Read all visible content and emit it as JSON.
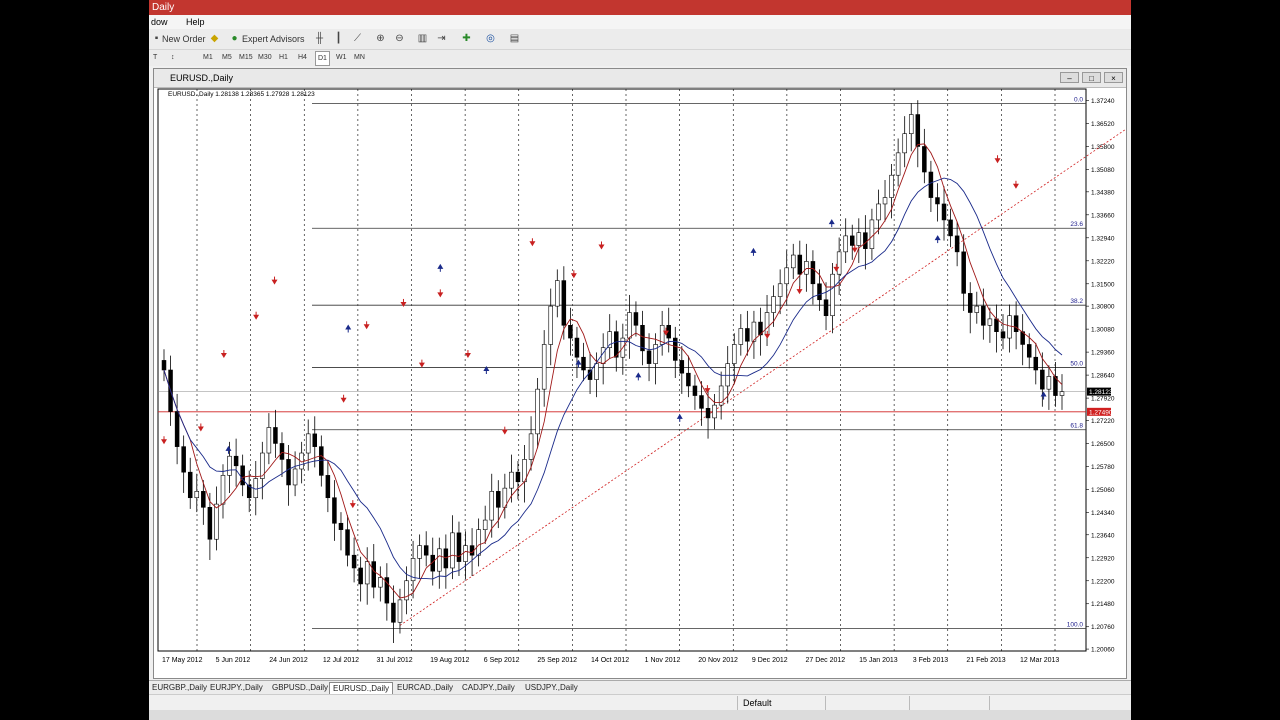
{
  "app": {
    "title": "Daily"
  },
  "menu": [
    "dow",
    "Help"
  ],
  "toolbar": {
    "new_order": "New Order",
    "expert_advisors": "Expert Advisors",
    "timeframes": [
      "M1",
      "M5",
      "M15",
      "M30",
      "H1",
      "H4",
      "D1",
      "W1",
      "MN"
    ],
    "active_timeframe": "D1"
  },
  "chart_window": {
    "title": "EURUSD.,Daily"
  },
  "chart_data": {
    "type": "candlestick",
    "info_line": "EURUSD.,Daily  1.28138 1.28365 1.27928 1.28123",
    "price_labels": [
      "1.37240",
      "1.36520",
      "1.35800",
      "1.35080",
      "1.34380",
      "1.33660",
      "1.32940",
      "1.32220",
      "1.31500",
      "1.30800",
      "1.30080",
      "1.29360",
      "1.28640",
      "1.27920",
      "1.27220",
      "1.26500",
      "1.25780",
      "1.25060",
      "1.24340",
      "1.23640",
      "1.22920",
      "1.22200",
      "1.21480",
      "1.20760",
      "1.20060"
    ],
    "current_price": "1.28123",
    "marker_price": "1.27490",
    "date_labels": [
      "17 May 2012",
      "5 Jun 2012",
      "24 Jun 2012",
      "12 Jul 2012",
      "31 Jul 2012",
      "19 Aug 2012",
      "6 Sep 2012",
      "25 Sep 2012",
      "14 Oct 2012",
      "1 Nov 2012",
      "20 Nov 2012",
      "9 Dec 2012",
      "27 Dec 2012",
      "15 Jan 2013",
      "3 Feb 2013",
      "21 Feb 2013",
      "12 Mar 2013"
    ],
    "fibonacci": [
      {
        "label": "0.0",
        "price": 1.3715
      },
      {
        "label": "23.6",
        "price": 1.3324
      },
      {
        "label": "38.2",
        "price": 1.3083
      },
      {
        "label": "50.0",
        "price": 1.2888
      },
      {
        "label": "61.8",
        "price": 1.2693
      },
      {
        "label": "100.0",
        "price": 1.207
      }
    ],
    "ylim": [
      1.2,
      1.376
    ],
    "closes": [
      1.288,
      1.275,
      1.264,
      1.256,
      1.248,
      1.25,
      1.245,
      1.235,
      1.246,
      1.255,
      1.261,
      1.258,
      1.252,
      1.248,
      1.254,
      1.262,
      1.27,
      1.265,
      1.26,
      1.252,
      1.257,
      1.262,
      1.268,
      1.264,
      1.255,
      1.248,
      1.24,
      1.238,
      1.23,
      1.226,
      1.221,
      1.228,
      1.22,
      1.223,
      1.215,
      1.209,
      1.216,
      1.222,
      1.229,
      1.233,
      1.23,
      1.225,
      1.232,
      1.226,
      1.237,
      1.228,
      1.233,
      1.23,
      1.238,
      1.241,
      1.25,
      1.245,
      1.251,
      1.256,
      1.253,
      1.26,
      1.268,
      1.282,
      1.296,
      1.308,
      1.316,
      1.302,
      1.298,
      1.292,
      1.288,
      1.285,
      1.29,
      1.295,
      1.3,
      1.292,
      1.298,
      1.306,
      1.302,
      1.294,
      1.29,
      1.296,
      1.302,
      1.298,
      1.291,
      1.287,
      1.283,
      1.28,
      1.276,
      1.273,
      1.277,
      1.283,
      1.29,
      1.296,
      1.301,
      1.297,
      1.303,
      1.299,
      1.306,
      1.311,
      1.315,
      1.32,
      1.324,
      1.318,
      1.322,
      1.315,
      1.31,
      1.305,
      1.318,
      1.325,
      1.33,
      1.327,
      1.331,
      1.326,
      1.335,
      1.34,
      1.342,
      1.349,
      1.356,
      1.362,
      1.368,
      1.358,
      1.35,
      1.342,
      1.34,
      1.335,
      1.33,
      1.325,
      1.312,
      1.306,
      1.308,
      1.302,
      1.304,
      1.3,
      1.298,
      1.305,
      1.3,
      1.296,
      1.292,
      1.288,
      1.282,
      1.286,
      1.28,
      1.2812
    ],
    "fractals_up": [
      [
        14,
        1.263
      ],
      [
        40,
        1.301
      ],
      [
        60,
        1.32
      ],
      [
        70,
        1.288
      ],
      [
        90,
        1.29
      ],
      [
        103,
        1.286
      ],
      [
        112,
        1.273
      ],
      [
        128,
        1.325
      ],
      [
        145,
        1.334
      ],
      [
        168,
        1.329
      ],
      [
        191,
        1.28
      ]
    ],
    "fractals_down": [
      [
        0,
        1.266
      ],
      [
        8,
        1.27
      ],
      [
        13,
        1.293
      ],
      [
        20,
        1.305
      ],
      [
        24,
        1.316
      ],
      [
        39,
        1.279
      ],
      [
        41,
        1.246
      ],
      [
        44,
        1.302
      ],
      [
        52,
        1.309
      ],
      [
        56,
        1.29
      ],
      [
        60,
        1.312
      ],
      [
        66,
        1.293
      ],
      [
        74,
        1.269
      ],
      [
        80,
        1.328
      ],
      [
        89,
        1.318
      ],
      [
        95,
        1.327
      ],
      [
        109,
        1.3
      ],
      [
        118,
        1.282
      ],
      [
        131,
        1.299
      ],
      [
        138,
        1.313
      ],
      [
        146,
        1.32
      ],
      [
        150,
        1.326
      ],
      [
        181,
        1.354
      ],
      [
        185,
        1.346
      ]
    ]
  },
  "tabs": [
    "EURGBP.,Daily",
    "EURJPY.,Daily",
    "GBPUSD.,Daily",
    "EURUSD.,Daily",
    "EURCAD.,Daily",
    "CADJPY.,Daily",
    "USDJPY.,Daily"
  ],
  "active_tab": "EURUSD.,Daily",
  "status": {
    "profile": "Default"
  }
}
